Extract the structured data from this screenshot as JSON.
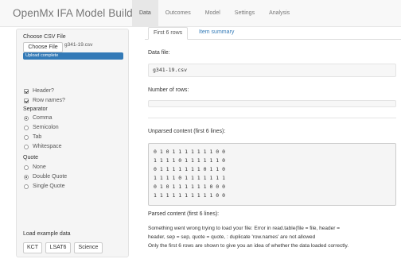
{
  "navbar": {
    "brand": "OpenMx IFA Model Builder",
    "tabs": [
      {
        "label": "Data",
        "active": true
      },
      {
        "label": "Outcomes"
      },
      {
        "label": "Model"
      },
      {
        "label": "Settings"
      },
      {
        "label": "Analysis"
      }
    ]
  },
  "sidebar": {
    "choose_csv_label": "Choose CSV File",
    "choose_file_button": "Choose File",
    "file_name": "g341-19.csv",
    "progress_text": "Upload complete",
    "progress_fraction": 1.0,
    "header_label": "Header?",
    "header_checked": true,
    "rownames_label": "Row names?",
    "rownames_checked": true,
    "separator_label": "Separator",
    "separator_options": [
      "Comma",
      "Semicolon",
      "Tab",
      "Whitespace"
    ],
    "separator_selected": "Comma",
    "quote_label": "Quote",
    "quote_options": [
      "None",
      "Double Quote",
      "Single Quote"
    ],
    "quote_selected": "Double Quote",
    "example_label": "Load example data",
    "example_buttons": [
      "KCT",
      "LSAT6",
      "Science"
    ]
  },
  "main": {
    "tabs": [
      "First 6 rows",
      "Item summary"
    ],
    "data_file_label": "Data file:",
    "data_file_value": "g341-19.csv",
    "rows_label": "Number of rows:",
    "rows_value": "",
    "unparsed_label": "Unparsed content (first 6 lines):",
    "unparsed_lines": [
      "0 1 0 1 1 1 1 1 1 1 0 0",
      "1 1 1 1 0 1 1 1 1 1 1 0",
      "0 1 1 1 1 1 1 1 0 1 1 0",
      "1 1 1 1 0 1 1 1 1 1 1 1",
      "0 1 0 1 1 1 1 1 1 0 0 0",
      "1 1 1 1 1 1 1 1 1 1 0 0"
    ],
    "parsed_label": "Parsed content (first 6 lines):",
    "error_lines": [
      "Something went wrong trying to load your file: Error in read.table(file = file, header =",
      "header, sep = sep, quote = quote, : duplicate 'row.names' are not allowed",
      "Only the first 6 rows are shown to give you an idea of whether the data loaded correctly."
    ]
  },
  "colors": {
    "accent": "#337ab7",
    "navbar_bg": "#f8f8f8",
    "sidebar_bg": "#f5f5f5"
  }
}
